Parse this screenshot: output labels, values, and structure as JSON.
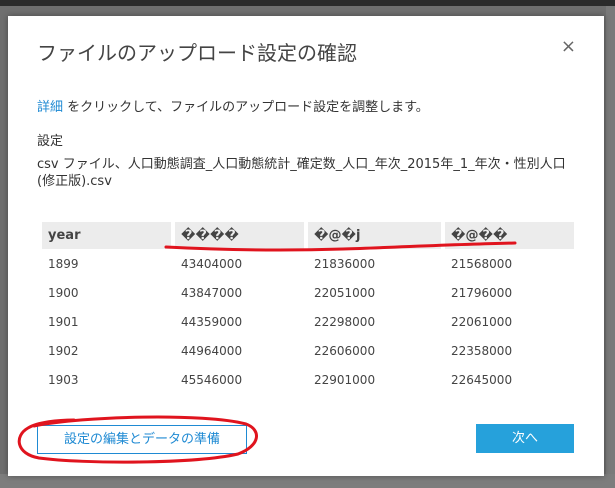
{
  "dialog": {
    "title": "ファイルのアップロード設定の確認",
    "close_glyph": "×",
    "instruction_link": "詳細",
    "instruction_text": " をクリックして、ファイルのアップロード設定を調整します。",
    "settings_label": "設定",
    "settings_value": "csv ファイル、人口動態調査_人口動態統計_確定数_人口_年次_2015年_1_年次・性別人口(修正版).csv"
  },
  "table": {
    "headers": [
      "year",
      "����",
      "�@�j",
      "�@��"
    ],
    "rows": [
      [
        "1899",
        "43404000",
        "21836000",
        "21568000"
      ],
      [
        "1900",
        "43847000",
        "22051000",
        "21796000"
      ],
      [
        "1901",
        "44359000",
        "22298000",
        "22061000"
      ],
      [
        "1902",
        "44964000",
        "22606000",
        "22358000"
      ],
      [
        "1903",
        "45546000",
        "22901000",
        "22645000"
      ]
    ]
  },
  "buttons": {
    "edit_label": "設定の編集とデータの準備",
    "next_label": "次へ"
  },
  "colors": {
    "accent": "#26a1db",
    "link": "#1f8ad3",
    "annotation": "#e0141e"
  }
}
